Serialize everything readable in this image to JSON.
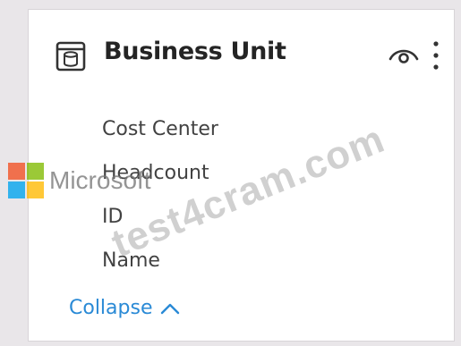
{
  "card": {
    "title": "Business Unit",
    "icons": {
      "entity": "table-icon",
      "visibility": "eye-icon",
      "menu": "more-vertical-icon"
    },
    "fields": [
      "Cost Center",
      "Headcount",
      "ID",
      "Name"
    ],
    "collapse_label": "Collapse",
    "collapse_icon": "chevron-up-icon",
    "colors": {
      "link": "#2a8ad6",
      "text": "#424242",
      "title": "#242424"
    }
  },
  "watermark": {
    "logo_text": "Microsoft",
    "stamp_text": "test4cram.com",
    "logo_colors": [
      "#f25022",
      "#7fba00",
      "#00a4ef",
      "#ffb900"
    ]
  }
}
